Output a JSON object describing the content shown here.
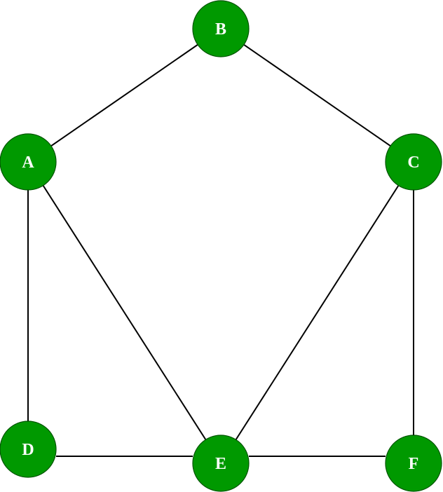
{
  "colors": {
    "node_fill": "#009900",
    "edge": "#000000",
    "label": "#ffffff"
  },
  "nodes": [
    {
      "id": "A",
      "label": "A"
    },
    {
      "id": "B",
      "label": "B"
    },
    {
      "id": "C",
      "label": "C"
    },
    {
      "id": "D",
      "label": "D"
    },
    {
      "id": "E",
      "label": "E"
    },
    {
      "id": "F",
      "label": "F"
    }
  ],
  "edges": [
    {
      "from": "A",
      "to": "B"
    },
    {
      "from": "B",
      "to": "C"
    },
    {
      "from": "A",
      "to": "D"
    },
    {
      "from": "A",
      "to": "E"
    },
    {
      "from": "C",
      "to": "E"
    },
    {
      "from": "C",
      "to": "F"
    },
    {
      "from": "D",
      "to": "E"
    },
    {
      "from": "E",
      "to": "F"
    }
  ]
}
